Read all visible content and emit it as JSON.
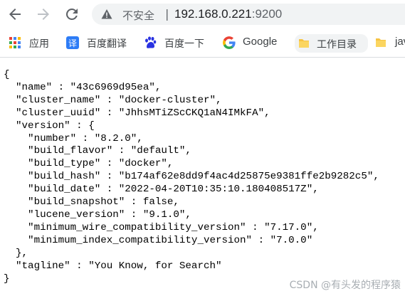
{
  "browser": {
    "security_label": "不安全",
    "separator": "|",
    "url_host": "192.168.0.221",
    "url_port": ":9200",
    "bookmarks": [
      {
        "label": "应用",
        "icon": "apps-grid-icon"
      },
      {
        "label": "百度翻译",
        "icon": "baidu-translate-icon"
      },
      {
        "label": "百度一下",
        "icon": "baidu-paw-icon"
      },
      {
        "label": "Google",
        "icon": "google-icon"
      },
      {
        "label": "工作目录",
        "icon": "folder-icon"
      },
      {
        "label": "jav",
        "icon": "folder-icon"
      }
    ]
  },
  "response_lines": [
    "{",
    "  \"name\" : \"43c6969d95ea\",",
    "  \"cluster_name\" : \"docker-cluster\",",
    "  \"cluster_uuid\" : \"JhhsMTiZScCKQ1aN4IMkFA\",",
    "  \"version\" : {",
    "    \"number\" : \"8.2.0\",",
    "    \"build_flavor\" : \"default\",",
    "    \"build_type\" : \"docker\",",
    "    \"build_hash\" : \"b174af62e8dd9f4ac4d25875e9381ffe2b9282c5\",",
    "    \"build_date\" : \"2022-04-20T10:35:10.180408517Z\",",
    "    \"build_snapshot\" : false,",
    "    \"lucene_version\" : \"9.1.0\",",
    "    \"minimum_wire_compatibility_version\" : \"7.17.0\",",
    "    \"minimum_index_compatibility_version\" : \"7.0.0\"",
    "  },",
    "  \"tagline\" : \"You Know, for Search\"",
    "}"
  ],
  "watermark": "CSDN @有头发的程序猿"
}
